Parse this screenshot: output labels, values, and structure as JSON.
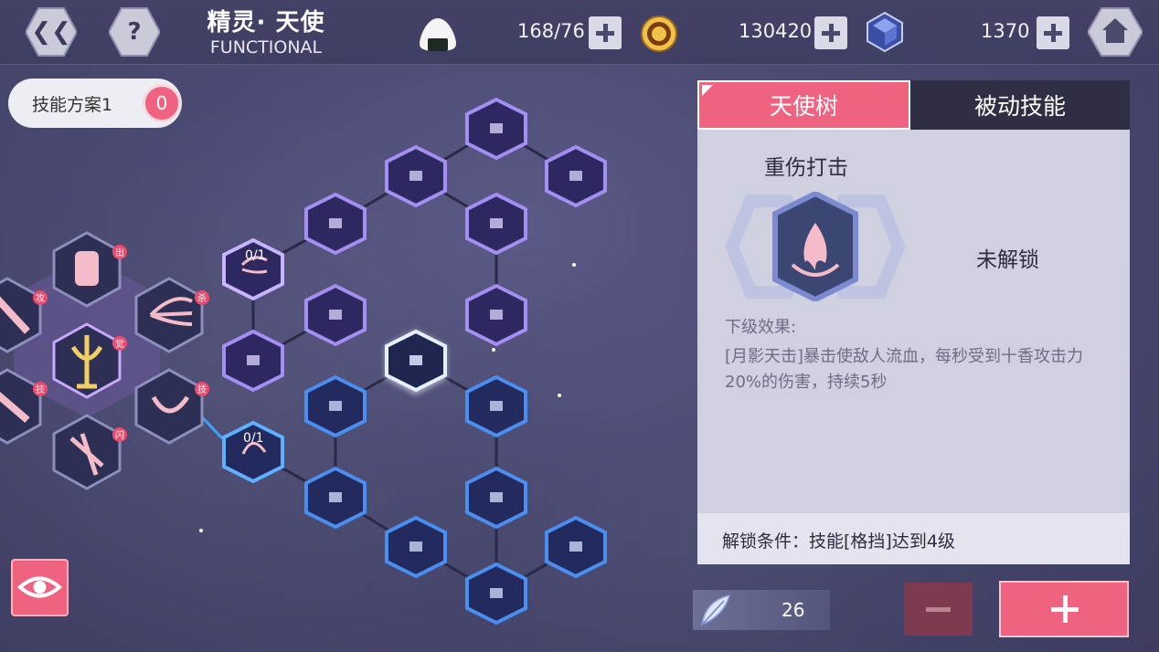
{
  "header": {
    "title_cn": "精灵· 天使",
    "title_en": "FUNCTIONAL",
    "stamina": "168/76",
    "gold": "130420",
    "gems": "1370"
  },
  "plan": {
    "label": "技能方案1",
    "count": "0"
  },
  "tree_labels": {
    "node_a": "0/1",
    "node_b": "0/1"
  },
  "panel": {
    "tab_active": "天使树",
    "tab_inactive": "被动技能",
    "skill_name": "重伤打击",
    "lock_state": "未解锁",
    "effect_title": "下级效果:",
    "effect_desc": "[月影天击]暴击使敌人流血，每秒受到十香攻击力20%的伤害，持续5秒",
    "unlock_cond": "解锁条件：技能[格挡]达到4级"
  },
  "footer": {
    "feather_count": "26"
  },
  "colors": {
    "accent": "#ef6381",
    "bg": "#4b4a72",
    "panel": "#cfd0e0"
  }
}
